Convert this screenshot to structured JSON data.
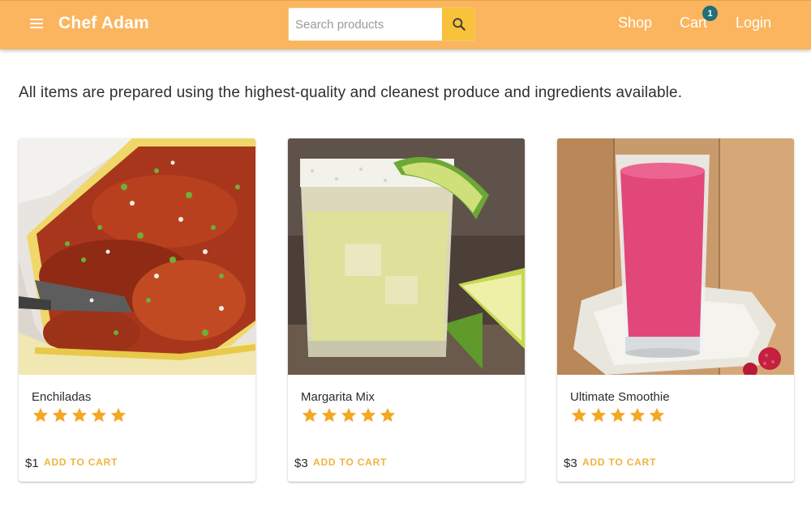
{
  "header": {
    "brand": "Chef Adam",
    "search_placeholder": "Search products",
    "nav": {
      "shop": "Shop",
      "cart": "Cart",
      "login": "Login"
    },
    "cart_count": "1"
  },
  "tagline": "All items are prepared using the highest-quality and cleanest produce and ingredients available.",
  "products": [
    {
      "name": "Enchiladas",
      "price": "$1",
      "rating": 5,
      "add_label": "ADD TO CART"
    },
    {
      "name": "Margarita Mix",
      "price": "$3",
      "rating": 5,
      "add_label": "ADD TO CART"
    },
    {
      "name": "Ultimate Smoothie",
      "price": "$3",
      "rating": 5,
      "add_label": "ADD TO CART"
    }
  ],
  "colors": {
    "appbar": "#fbb55f",
    "accent": "#f2b33d",
    "star": "#f5a623",
    "badge": "#1f6f78"
  }
}
